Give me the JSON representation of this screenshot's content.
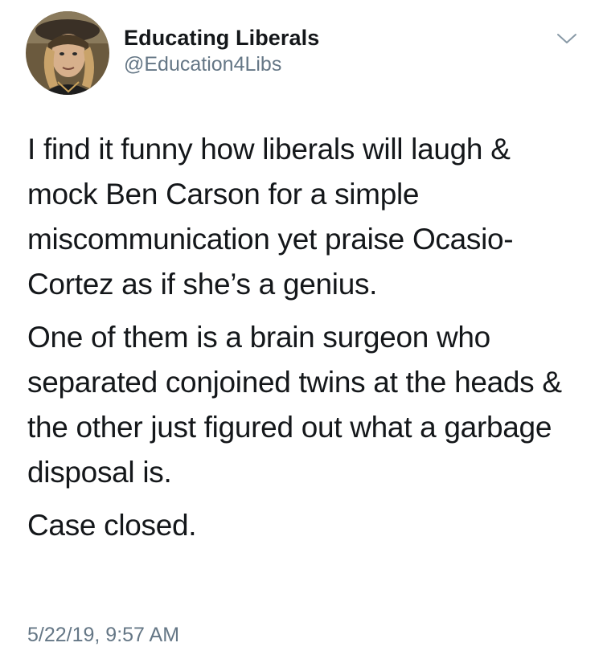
{
  "author": {
    "display_name": "Educating Liberals",
    "handle": "@Education4Libs",
    "avatar_icon": "profile-photo"
  },
  "menu_icon": "chevron-down-icon",
  "tweet": {
    "paragraphs": [
      "I find it funny how liberals will laugh & mock Ben Carson for a simple miscommunication yet praise Ocasio-Cortez as if she’s a genius.",
      "One of them is a brain surgeon who separated conjoined twins at the heads & the other just figured out what a garbage disposal is.",
      "Case closed."
    ],
    "timestamp": "5/22/19, 9:57 AM"
  },
  "colors": {
    "text": "#14171a",
    "secondary": "#657786",
    "caret": "#8899a6"
  }
}
